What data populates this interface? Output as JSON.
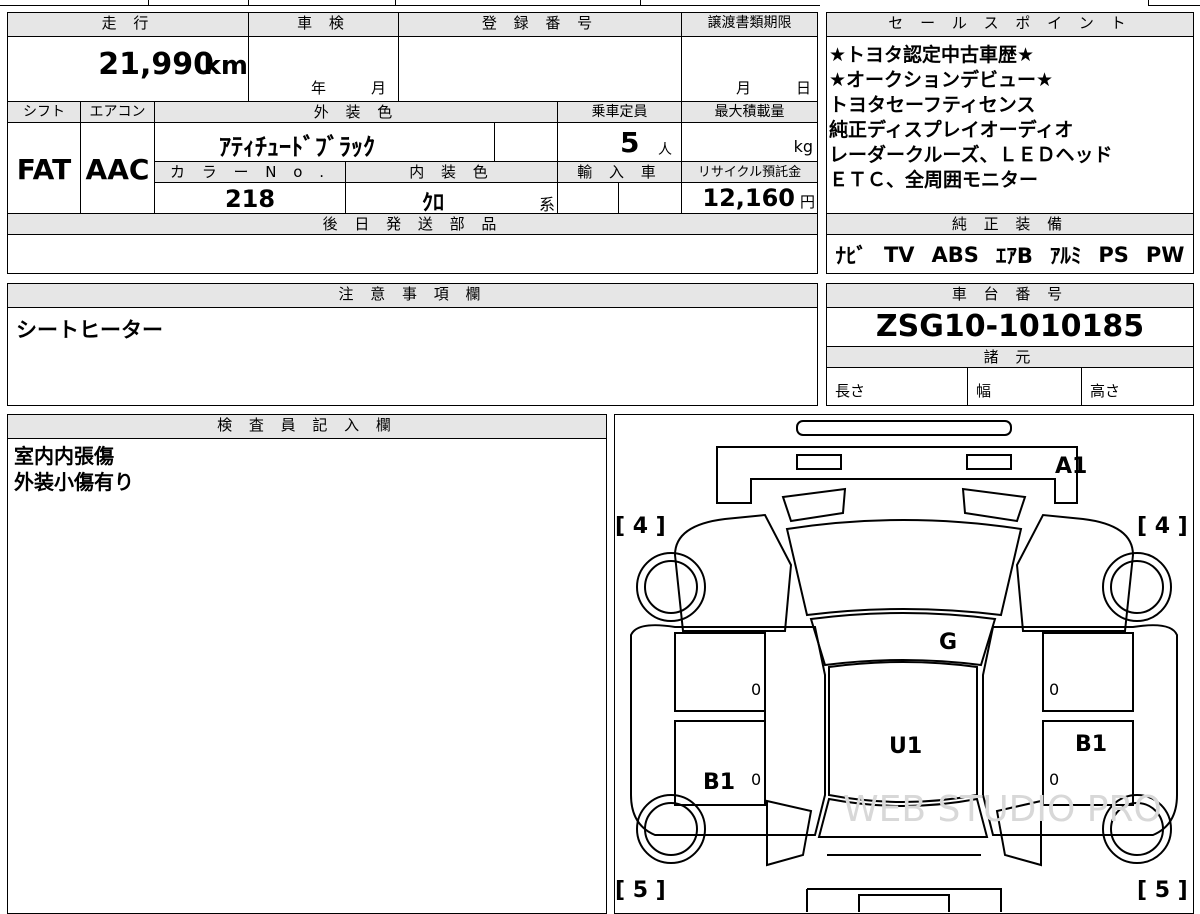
{
  "top": {
    "mileage_label": "走 行",
    "mileage_value": "21,990",
    "mileage_unit": "km",
    "inspection_label": "車 検",
    "inspection_year": "年",
    "inspection_month": "月",
    "registration_label": "登 録 番 号",
    "transfer_label": "譲渡書類期限",
    "transfer_month": "月",
    "transfer_day": "日",
    "shift_label": "シフト",
    "shift_value": "FAT",
    "ac_label": "エアコン",
    "ac_value": "AAC",
    "exterior_label": "外 装 色",
    "exterior_value": "ｱﾃｨﾁｭｰﾄﾞﾌﾞﾗｯｸ",
    "capacity_label": "乗車定員",
    "capacity_value": "5",
    "capacity_unit": "人",
    "maxload_label": "最大積載量",
    "maxload_unit": "kg",
    "color_no_label": "カ ラ ー N o .",
    "color_no_value": "218",
    "interior_label": "内 装 色",
    "interior_value": "ｸﾛ",
    "interior_suffix": "系",
    "import_label": "輸 入 車",
    "recycle_label": "リサイクル預託金",
    "recycle_value": "12,160",
    "recycle_unit": "円",
    "later_parts_label": "後 日 発 送 部 品"
  },
  "sales_points": {
    "header": "セ ー ル ス ポ イ ン ト",
    "lines": [
      "★トヨタ認定中古車歴★",
      "★オークションデビュー★",
      "トヨタセーフティセンス",
      "純正ディスプレイオーディオ",
      "レーダークルーズ、ＬＥＤヘッド",
      "ＥＴＣ、全周囲モニター"
    ],
    "equipment_header": "純 正 装 備",
    "equipment": [
      "ﾅﾋﾞ",
      "TV",
      "ABS",
      "ｴｱB",
      "ｱﾙﾐ",
      "PS",
      "PW"
    ]
  },
  "notes": {
    "header": "注 意 事 項 欄",
    "text": "シートヒーター"
  },
  "chassis": {
    "header": "車 台 番 号",
    "number": "ZSG10-1010185",
    "specs_header": "諸 元",
    "length_label": "長さ",
    "width_label": "幅",
    "height_label": "高さ"
  },
  "inspector": {
    "header": "検 査 員 記 入 欄",
    "lines": [
      "室内内張傷",
      "外装小傷有り"
    ]
  },
  "diagram": {
    "marks": {
      "front_bumper": "A1",
      "tire_fl": "[ 4 ]",
      "tire_fr": "[ 4 ]",
      "windshield": "G",
      "roof": "U1",
      "left_door_rear": "B1",
      "right_door_rear": "B1",
      "tire_rl": "[ 5 ]",
      "tire_rr": "[ 5 ]",
      "zero_1": "0",
      "zero_2": "0",
      "zero_3": "0",
      "zero_4": "0"
    },
    "watermark": "WEB STUDIO PRO"
  }
}
